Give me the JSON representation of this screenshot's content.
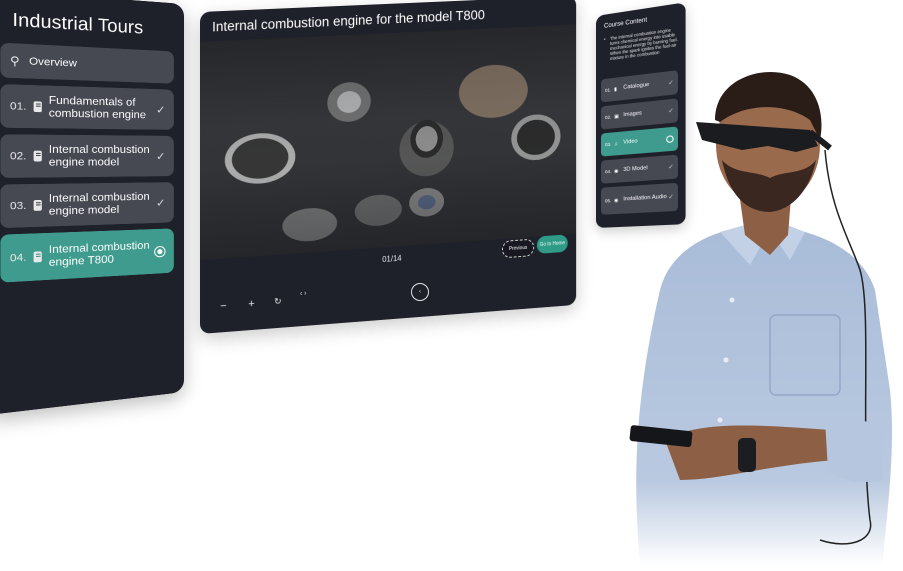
{
  "left_panel": {
    "title": "Industrial Tours",
    "overview": {
      "label": "Overview",
      "icon": "map-pin-route-icon"
    },
    "items": [
      {
        "number": "01.",
        "label": "Fundamentals of combustion engine",
        "status": "completed",
        "icon": "document-icon"
      },
      {
        "number": "02.",
        "label": "Internal combustion engine model",
        "status": "completed",
        "icon": "document-icon"
      },
      {
        "number": "03.",
        "label": "Internal combustion engine model",
        "status": "completed",
        "icon": "document-icon"
      },
      {
        "number": "04.",
        "label": "Internal combustion engine T800",
        "status": "active",
        "icon": "document-icon"
      }
    ],
    "check_glyph": "✓",
    "ov_glyph": "⚲"
  },
  "main_panel": {
    "title": "Internal combustion engine for the model T800",
    "image_alt": "Disassembled engine and gearbox parts",
    "previous_label": "Previous",
    "next_label": "Go to Home",
    "page_counter": "01/14",
    "controls": {
      "zoom_out": "−",
      "zoom_in": "+",
      "reset": "↻",
      "code": "‹ ›"
    },
    "ghost_glyph": "‹"
  },
  "right_panel": {
    "title": "Course Content",
    "description": "The internal combustion engine turns chemical energy into usable mechanical energy by burning fuel. When the spark ignites the fuel-air mixture in the combustion",
    "items": [
      {
        "number": "01.",
        "label": "Catalogue",
        "icon": "file-icon",
        "icon_glyph": "▮",
        "status": "completed"
      },
      {
        "number": "02.",
        "label": "Images",
        "icon": "image-icon",
        "icon_glyph": "▣",
        "status": "completed"
      },
      {
        "number": "03.",
        "label": "Video",
        "icon": "music-video-icon",
        "icon_glyph": "♫",
        "status": "active"
      },
      {
        "number": "04.",
        "label": "3D Model",
        "icon": "cube-icon",
        "icon_glyph": "◉",
        "status": "completed"
      },
      {
        "number": "05.",
        "label": "Installation Audio",
        "icon": "audio-icon",
        "icon_glyph": "◉",
        "status": "completed"
      }
    ],
    "check_glyph": "✓"
  },
  "colors": {
    "panel_bg": "#1f212a",
    "item_bg": "#464852",
    "accent_teal": "#3f9b8d",
    "button_teal": "#2f9a86"
  }
}
